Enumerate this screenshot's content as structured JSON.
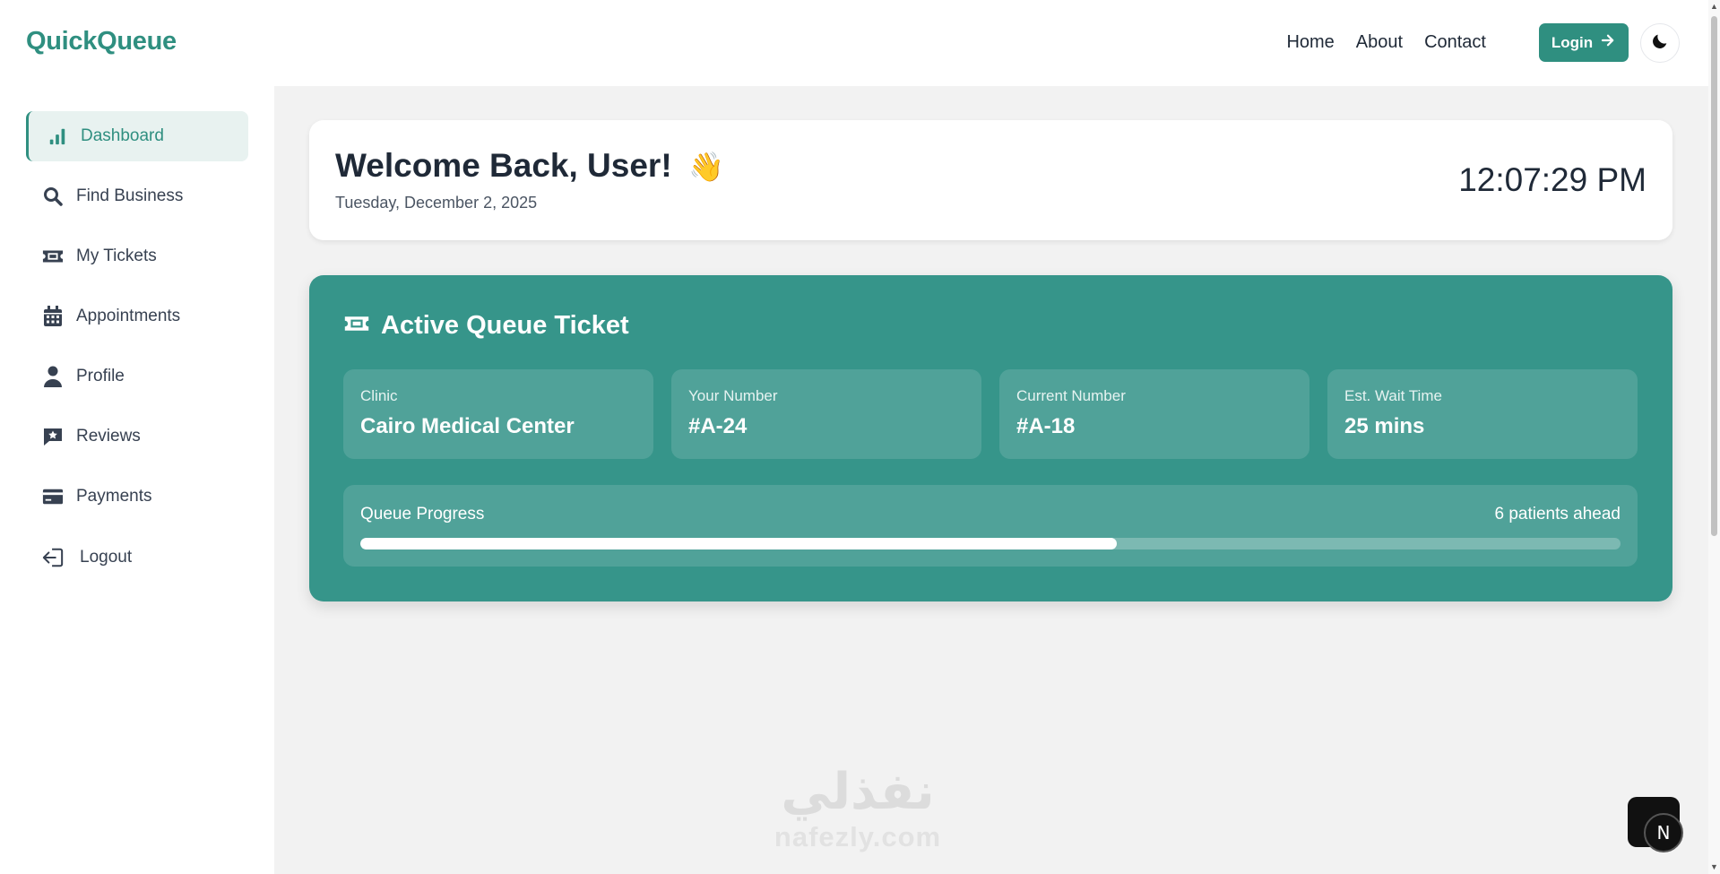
{
  "header": {
    "brand": "QuickQueue",
    "nav": [
      "Home",
      "About",
      "Contact"
    ],
    "login_label": "Login",
    "theme_icon": "moon-icon"
  },
  "sidebar": {
    "items": [
      {
        "label": "Dashboard",
        "icon": "bar-chart-icon",
        "active": true
      },
      {
        "label": "Find Business",
        "icon": "search-icon"
      },
      {
        "label": "My Tickets",
        "icon": "ticket-icon"
      },
      {
        "label": "Appointments",
        "icon": "calendar-icon"
      },
      {
        "label": "Profile",
        "icon": "user-icon"
      },
      {
        "label": "Reviews",
        "icon": "review-icon"
      },
      {
        "label": "Payments",
        "icon": "credit-card-icon"
      },
      {
        "label": "Logout",
        "icon": "logout-icon"
      }
    ]
  },
  "welcome": {
    "title": "Welcome Back, User!",
    "emoji": "👋",
    "date": "Tuesday, December 2, 2025",
    "time": "12:07:29 PM"
  },
  "ticket": {
    "title": "Active Queue Ticket",
    "cards": [
      {
        "label": "Clinic",
        "value": "Cairo Medical Center"
      },
      {
        "label": "Your Number",
        "value": "#A-24"
      },
      {
        "label": "Current Number",
        "value": "#A-18"
      },
      {
        "label": "Est. Wait Time",
        "value": "25 mins"
      }
    ],
    "progress_label": "Queue Progress",
    "patients_ahead": "6 patients ahead",
    "progress_fraction": 0.6
  },
  "watermark": {
    "arabic": "نفذلي",
    "latin": "nafezly.com"
  },
  "colors": {
    "accent": "#2f8f80",
    "ticket_bg": "#36958a",
    "page_bg": "#f2f2f2"
  }
}
